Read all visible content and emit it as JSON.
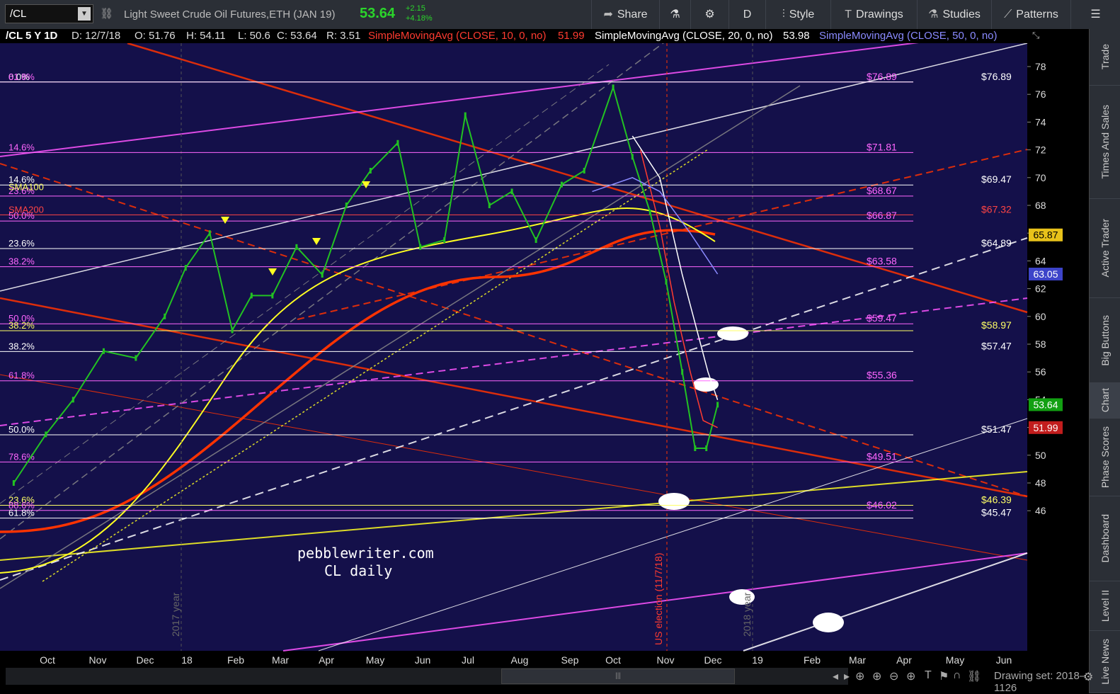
{
  "toolbar": {
    "symbol": "/CL",
    "symbol_caret": "▼",
    "link_icon": "link-icon",
    "description": "Light Sweet Crude Oil Futures,ETH (JAN 19)",
    "last": "53.64",
    "change_abs": "+2.15",
    "change_pct": "+4.18%",
    "share_label": "Share",
    "flask_icon": "flask-icon",
    "gear_icon": "gear-icon",
    "period_label": "D",
    "style_label": "Style",
    "drawings_label": "Drawings",
    "studies_label": "Studies",
    "patterns_label": "Patterns",
    "menu_icon": "menu-icon"
  },
  "annotations": {
    "header": "/CL 5 Y 1D",
    "date": "D: 12/7/18",
    "open": "O: 51.76",
    "high": "H: 54.11",
    "low": "L: 50.6",
    "close": "C: 53.64",
    "range": "R: 3.51",
    "sma10_label": "SimpleMovingAvg (CLOSE, 10, 0, no)",
    "sma10_value": "51.99",
    "sma20_label": "SimpleMovingAvg (CLOSE, 20, 0, no)",
    "sma20_value": "53.98",
    "sma50_label": "SimpleMovingAvg (CLOSE, 50, 0, no)",
    "colors": {
      "sma10": "#ff3b30",
      "sma20": "#ffffff",
      "sma50": "#8a8aff"
    }
  },
  "sidebar": {
    "tabs": [
      "Trade",
      "Times And Sales",
      "Active Trader",
      "Big Buttons",
      "Chart",
      "Phase Scores",
      "Dashboard",
      "Level II",
      "Live News"
    ],
    "active": "Chart"
  },
  "bottom": {
    "drawing_set": "Drawing set: 2018–1126",
    "scroll_grip": "|||"
  },
  "chart_data": {
    "type": "line",
    "title": "Light Sweet Crude Oil Futures,ETH (JAN 19)",
    "subtitle": "/CL 5 Y 1D",
    "xlabel": "",
    "ylabel": "",
    "ylim": [
      44,
      79
    ],
    "yticks": [
      46,
      48,
      50,
      52,
      54,
      56,
      58,
      60,
      62,
      64,
      66,
      68,
      70,
      72,
      74,
      76,
      78
    ],
    "x_ticks": [
      "Oct",
      "Nov",
      "Dec",
      "18",
      "Feb",
      "Mar",
      "Apr",
      "May",
      "Jun",
      "Jul",
      "Aug",
      "Sep",
      "Oct",
      "Nov",
      "Dec",
      "19",
      "Feb",
      "Mar",
      "Apr",
      "May",
      "Jun"
    ],
    "grid": false,
    "legend": "top-left",
    "series": [
      {
        "name": "/CL close",
        "color": "#22c222",
        "x": [
          "2017-09-25",
          "2017-10-15",
          "2017-11-01",
          "2017-11-20",
          "2017-12-10",
          "2017-12-28",
          "2018-01-10",
          "2018-01-25",
          "2018-02-08",
          "2018-02-20",
          "2018-03-05",
          "2018-03-20",
          "2018-04-05",
          "2018-04-20",
          "2018-05-05",
          "2018-05-22",
          "2018-06-05",
          "2018-06-20",
          "2018-07-03",
          "2018-07-18",
          "2018-08-01",
          "2018-08-16",
          "2018-09-01",
          "2018-09-15",
          "2018-10-03",
          "2018-10-15",
          "2018-10-26",
          "2018-11-05",
          "2018-11-15",
          "2018-11-23",
          "2018-11-30",
          "2018-12-07"
        ],
        "values": [
          48.0,
          51.5,
          54.0,
          57.5,
          57.0,
          60.0,
          63.5,
          66.0,
          59.0,
          61.5,
          61.5,
          65.0,
          63.0,
          68.0,
          70.5,
          72.5,
          65.0,
          65.5,
          74.5,
          68.0,
          69.0,
          65.5,
          69.5,
          70.5,
          76.5,
          71.5,
          67.5,
          62.5,
          56.0,
          50.5,
          50.5,
          53.64
        ]
      },
      {
        "name": "SimpleMovingAvg (CLOSE, 10, 0, no)",
        "color": "#ff3b30",
        "x": [
          "2018-10-20",
          "2018-11-01",
          "2018-11-10",
          "2018-11-20",
          "2018-11-28",
          "2018-12-07"
        ],
        "values": [
          72.0,
          66.5,
          61.0,
          56.0,
          52.5,
          51.99
        ]
      },
      {
        "name": "SimpleMovingAvg (CLOSE, 20, 0, no)",
        "color": "#ffffff",
        "x": [
          "2018-10-15",
          "2018-11-01",
          "2018-11-15",
          "2018-12-01",
          "2018-12-07"
        ],
        "values": [
          73.0,
          70.0,
          63.0,
          56.0,
          53.98
        ]
      },
      {
        "name": "SimpleMovingAvg (CLOSE, 50, 0, no)",
        "color": "#8a8aff",
        "x": [
          "2018-09-20",
          "2018-10-15",
          "2018-11-01",
          "2018-11-20",
          "2018-12-07"
        ],
        "values": [
          69.0,
          70.0,
          69.0,
          66.0,
          63.05
        ]
      }
    ],
    "sma_tags": {
      "sma200_label": "SMA200",
      "sma100_label": "SMA100"
    },
    "price_levels": [
      {
        "label": "$76.89",
        "price": 76.89,
        "color": "#ff66ff"
      },
      {
        "label": "$76.89",
        "price": 76.89,
        "color": "#ffffff"
      },
      {
        "label": "$71.81",
        "price": 71.81,
        "color": "#ff66ff"
      },
      {
        "label": "$69.47",
        "price": 69.47,
        "color": "#ffffff"
      },
      {
        "label": "$68.67",
        "price": 68.67,
        "color": "#ff66ff"
      },
      {
        "label": "$67.32",
        "price": 67.32,
        "color": "#ff4444"
      },
      {
        "label": "$66.87",
        "price": 66.87,
        "color": "#ff66ff"
      },
      {
        "label": "$64.89",
        "price": 64.89,
        "color": "#ffffff"
      },
      {
        "label": "$63.58",
        "price": 63.58,
        "color": "#ff66ff"
      },
      {
        "label": "$59.47",
        "price": 59.47,
        "color": "#ff66ff"
      },
      {
        "label": "$58.97",
        "price": 58.97,
        "color": "#ffff66"
      },
      {
        "label": "$57.47",
        "price": 57.47,
        "color": "#ffffff"
      },
      {
        "label": "$55.36",
        "price": 55.36,
        "color": "#ff66ff"
      },
      {
        "label": "$51.47",
        "price": 51.47,
        "color": "#ffffff"
      },
      {
        "label": "$49.51",
        "price": 49.51,
        "color": "#ff66ff"
      },
      {
        "label": "$46.39",
        "price": 46.39,
        "color": "#ffff66"
      },
      {
        "label": "$46.02",
        "price": 46.02,
        "color": "#ff66ff"
      },
      {
        "label": "$45.47",
        "price": 45.47,
        "color": "#ffffff"
      }
    ],
    "fib_labels": [
      {
        "label": "0.0%",
        "price": 76.89,
        "color": "#ffffff"
      },
      {
        "label": "61.8%",
        "price": 76.89,
        "color": "#ff66ff"
      },
      {
        "label": "14.6%",
        "price": 71.81,
        "color": "#ff66ff"
      },
      {
        "label": "14.6%",
        "price": 69.47,
        "color": "#ffffff"
      },
      {
        "label": "23.6%",
        "price": 68.67,
        "color": "#ff66ff"
      },
      {
        "label": "50.0%",
        "price": 66.87,
        "color": "#ff66ff"
      },
      {
        "label": "23.6%",
        "price": 64.89,
        "color": "#ffffff"
      },
      {
        "label": "38.2%",
        "price": 63.58,
        "color": "#ff66ff"
      },
      {
        "label": "50.0%",
        "price": 59.47,
        "color": "#ff66ff"
      },
      {
        "label": "38.2%",
        "price": 58.97,
        "color": "#ffff66"
      },
      {
        "label": "38.2%",
        "price": 57.47,
        "color": "#ffffff"
      },
      {
        "label": "61.8%",
        "price": 55.36,
        "color": "#ff66ff"
      },
      {
        "label": "50.0%",
        "price": 51.47,
        "color": "#ffffff"
      },
      {
        "label": "78.6%",
        "price": 49.51,
        "color": "#ff66ff"
      },
      {
        "label": "23.6%",
        "price": 46.39,
        "color": "#ffff66"
      },
      {
        "label": "88.6%",
        "price": 46.02,
        "color": "#ff66ff"
      },
      {
        "label": "61.8%",
        "price": 45.47,
        "color": "#ffffff"
      }
    ],
    "axis_tags": [
      {
        "label": "65.87",
        "price": 65.87,
        "bg": "#e8c21a",
        "fg": "#000000"
      },
      {
        "label": "63.05",
        "price": 63.05,
        "bg": "#3d44c9",
        "fg": "#ffffff"
      },
      {
        "label": "53.64",
        "price": 53.64,
        "bg": "#12a012",
        "fg": "#ffffff"
      },
      {
        "label": "51.99",
        "price": 51.99,
        "bg": "#c21d1d",
        "fg": "#ffffff"
      }
    ],
    "watermark_line1": "pebblewriter.com",
    "watermark_line2": "CL daily",
    "vertical_labels": {
      "election": "US election (11/7/18)",
      "year2017": "2017 year",
      "year2018": "2018 year"
    }
  }
}
